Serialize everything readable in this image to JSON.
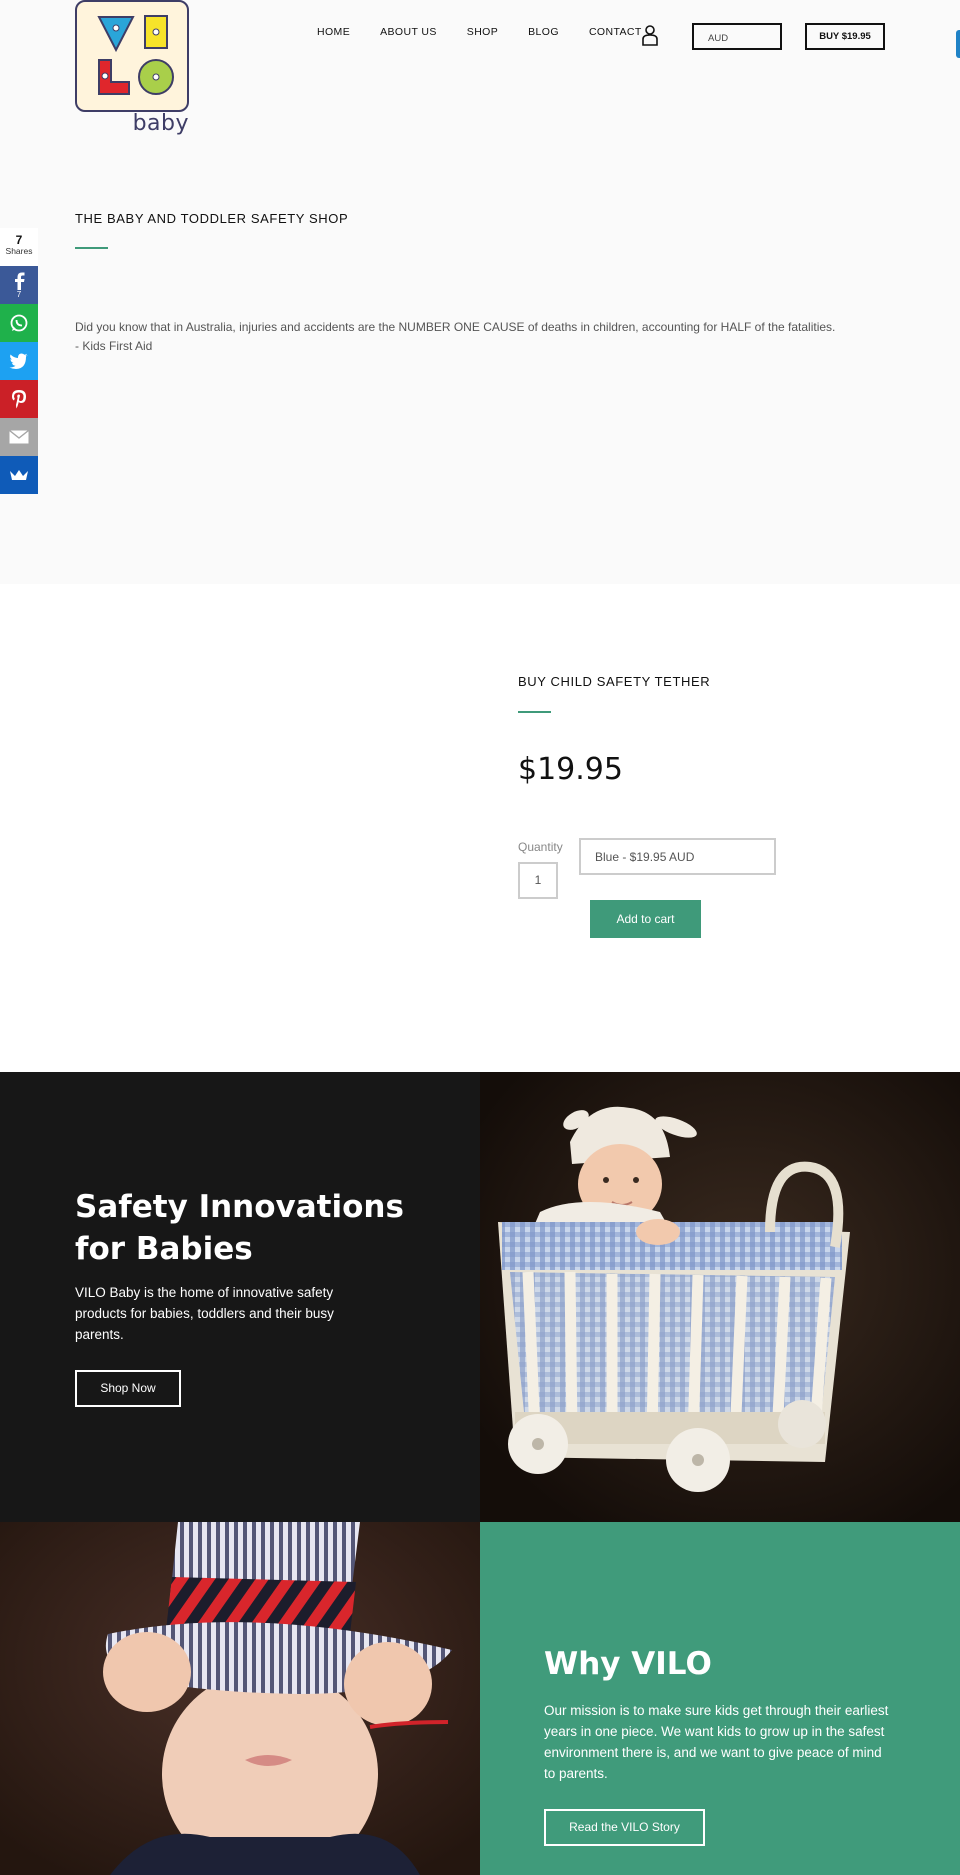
{
  "brand": {
    "logo_letters": [
      "V",
      "I",
      "L",
      "O"
    ],
    "logo_word": "baby",
    "colors": {
      "accent": "#3f9a7a",
      "dark": "#171717",
      "logo_outline": "#3e3d66",
      "logo_bg": "#fff4dc"
    }
  },
  "nav": {
    "items": [
      {
        "label": "HOME"
      },
      {
        "label": "ABOUT US"
      },
      {
        "label": "SHOP"
      },
      {
        "label": "BLOG"
      },
      {
        "label": "CONTACT"
      }
    ],
    "account_icon": "user-icon",
    "currency": "AUD",
    "buy_label": "BUY $19.95"
  },
  "hero": {
    "title": "THE BABY AND TODDLER SAFETY SHOP",
    "quote_line1": "Did you know that in Australia, injuries and accidents are the NUMBER ONE CAUSE of deaths in children, accounting for HALF of the fatalities.",
    "quote_line2": "- Kids First Aid"
  },
  "share": {
    "count": "7",
    "label": "Shares",
    "buttons": [
      {
        "network": "facebook",
        "icon": "facebook-icon",
        "count": "7",
        "color": "#3b5998"
      },
      {
        "network": "whatsapp",
        "icon": "whatsapp-icon",
        "color": "#1fb14b"
      },
      {
        "network": "twitter",
        "icon": "twitter-icon",
        "color": "#1da1f2"
      },
      {
        "network": "pinterest",
        "icon": "pinterest-icon",
        "color": "#cb2027"
      },
      {
        "network": "email",
        "icon": "email-icon",
        "color": "#a6a6a6"
      },
      {
        "network": "sumome",
        "icon": "crown-icon",
        "color": "#0f5bb8"
      }
    ]
  },
  "product": {
    "title": "BUY CHILD SAFETY TETHER",
    "price": "$19.95",
    "quantity_label": "Quantity",
    "quantity_value": "1",
    "variant": "Blue - $19.95 AUD",
    "cart_label": "Add to cart"
  },
  "features": {
    "safety": {
      "heading": "Safety Innovations for Babies",
      "body": "VILO Baby is the home of innovative safety products for babies, toddlers and their busy parents.",
      "button": "Shop Now"
    },
    "why": {
      "heading": "Why VILO",
      "body": "Our mission is to make sure kids get through their earliest years in one piece. We want kids to grow up in the safest environment there is, and we want to give peace of mind to parents.",
      "button": "Read the VILO Story"
    }
  }
}
